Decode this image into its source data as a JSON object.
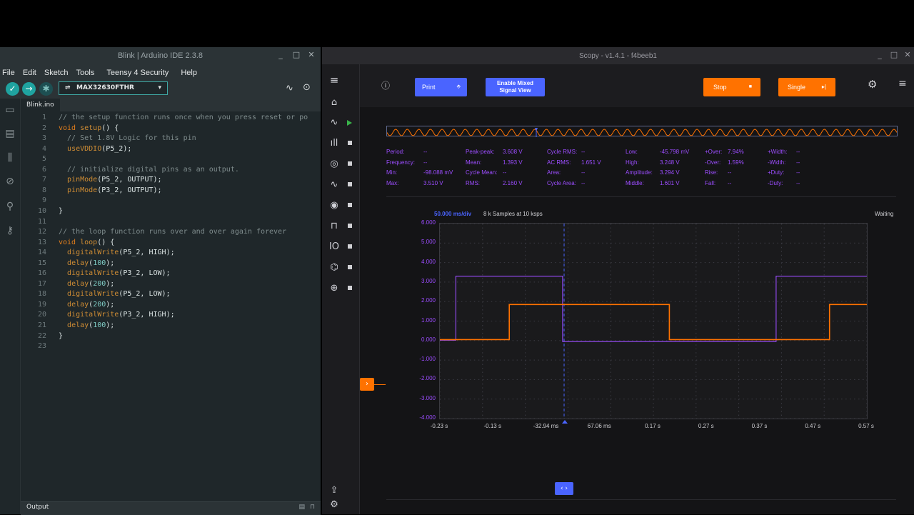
{
  "ide": {
    "title": "Blink | Arduino IDE 2.3.8",
    "menu": [
      "File",
      "Edit",
      "Sketch",
      "Tools",
      "Teensy 4 Security",
      "Help"
    ],
    "board": "MAX32630FTHR",
    "tab": "Blink.ino",
    "output_label": "Output",
    "code": [
      "// the setup function runs once when you press reset or po",
      "void setup() {",
      "  // Set 1.8V Logic for this pin",
      "  useVDDIO(P5_2);",
      "",
      "  // initialize digital pins as an output.",
      "  pinMode(P5_2, OUTPUT);",
      "  pinMode(P3_2, OUTPUT);",
      "",
      "}",
      "",
      "// the loop function runs over and over again forever",
      "void loop() {",
      "  digitalWrite(P5_2, HIGH);",
      "  delay(100);",
      "  digitalWrite(P3_2, LOW);",
      "  delay(200);",
      "  digitalWrite(P5_2, LOW);",
      "  delay(200);",
      "  digitalWrite(P3_2, HIGH);",
      "  delay(100);",
      "}",
      ""
    ]
  },
  "scopy": {
    "title": "Scopy - v1.4.1 - f4beeb1",
    "print_label": "Print",
    "mixed_label_1": "Enable Mixed",
    "mixed_label_2": "Signal View",
    "stop_label": "Stop",
    "single_label": "Single",
    "timebase": "50.000 ms/div",
    "samples": "8 k Samples at 10 ksps",
    "status": "Waiting",
    "measurements": [
      {
        "label": "Period:",
        "value": "--"
      },
      {
        "label": "Frequency:",
        "value": "--"
      },
      {
        "label": "Min:",
        "value": "-98.088 mV"
      },
      {
        "label": "Max:",
        "value": "3.510 V"
      },
      {
        "label": "Peak-peak:",
        "value": "3.608 V"
      },
      {
        "label": "Mean:",
        "value": "1.393 V"
      },
      {
        "label": "Cycle Mean:",
        "value": "--"
      },
      {
        "label": "RMS:",
        "value": "2.160 V"
      },
      {
        "label": "Cycle RMS:",
        "value": "--"
      },
      {
        "label": "AC RMS:",
        "value": "1.651 V"
      },
      {
        "label": "Area:",
        "value": "--"
      },
      {
        "label": "Cycle Area:",
        "value": "--"
      },
      {
        "label": "Low:",
        "value": "-45.798 mV"
      },
      {
        "label": "High:",
        "value": "3.248 V"
      },
      {
        "label": "Amplitude:",
        "value": "3.294 V"
      },
      {
        "label": "Middle:",
        "value": "1.601 V"
      },
      {
        "label": "+Over:",
        "value": "7.94%"
      },
      {
        "label": "-Over:",
        "value": "1.59%"
      },
      {
        "label": "Rise:",
        "value": "--"
      },
      {
        "label": "Fall:",
        "value": "--"
      },
      {
        "label": "+Width:",
        "value": "--"
      },
      {
        "label": "-Width:",
        "value": "--"
      },
      {
        "label": "+Duty:",
        "value": "--"
      },
      {
        "label": "-Duty:",
        "value": "--"
      }
    ],
    "y_ticks": [
      "6.000",
      "5.000",
      "4.000",
      "3.000",
      "2.000",
      "1.000",
      "0.000",
      "-1.000",
      "-2.000",
      "-3.000",
      "-4.000"
    ],
    "x_ticks": [
      "-0.23 s",
      "-0.13 s",
      "-32.94 ms",
      "67.06 ms",
      "0.17 s",
      "0.27 s",
      "0.37 s",
      "0.47 s",
      "0.57 s"
    ],
    "colors": {
      "ch1": "#9c4dff",
      "ch2": "#ff7200",
      "accent": "#4a64ff"
    }
  },
  "chart_data": {
    "type": "line",
    "x": [
      -0.23,
      -0.13,
      -0.03294,
      0.06706,
      0.17,
      0.27,
      0.37,
      0.47,
      0.57
    ],
    "xlim": [
      -0.23,
      0.57
    ],
    "ylim": [
      -4,
      6
    ],
    "series": [
      {
        "points": [
          [
            -0.23,
            0.02
          ],
          [
            -0.2,
            0.02
          ],
          [
            -0.2,
            3.3
          ],
          [
            0.0,
            3.3
          ],
          [
            0.0,
            -0.05
          ],
          [
            0.4,
            -0.05
          ],
          [
            0.4,
            3.3
          ],
          [
            0.57,
            3.3
          ]
        ]
      },
      {
        "points": [
          [
            -0.23,
            0.05
          ],
          [
            -0.1,
            0.05
          ],
          [
            -0.1,
            1.85
          ],
          [
            0.2,
            1.85
          ],
          [
            0.2,
            0.05
          ],
          [
            0.5,
            0.05
          ],
          [
            0.5,
            1.85
          ],
          [
            0.57,
            1.85
          ]
        ]
      }
    ]
  }
}
